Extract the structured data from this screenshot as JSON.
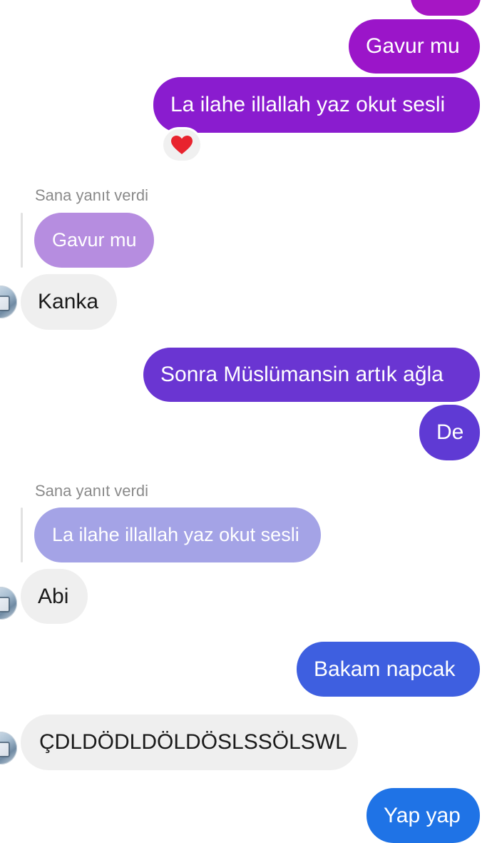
{
  "thread": {
    "reply_label": "Sana yanıt verdi",
    "messages": [
      {
        "id": "m1",
        "side": "out",
        "text": "Gavur mu",
        "color": "#9b15c9"
      },
      {
        "id": "m2",
        "side": "out",
        "text": "La ilahe illallah yaz okut sesli",
        "color": "#8a1ccf",
        "reaction": "heart-icon"
      },
      {
        "id": "m3",
        "side": "in",
        "reply_to": "Gavur mu",
        "reply_color": "#b68de0",
        "text": "Kanka"
      },
      {
        "id": "m4",
        "side": "out",
        "text": "Sonra Müslümansin artık ağla",
        "color": "#6a35d2"
      },
      {
        "id": "m5",
        "side": "out",
        "text": "De",
        "color": "#5f3ad4"
      },
      {
        "id": "m6",
        "side": "in",
        "reply_to": "La ilahe illallah yaz okut sesli",
        "reply_color": "#a4a3e6",
        "text": "Abi"
      },
      {
        "id": "m7",
        "side": "out",
        "text": "Bakam napcak",
        "color": "#3e5fe0"
      },
      {
        "id": "m8",
        "side": "in",
        "text": "ÇDLDÖDLDÖLDÖSLSSÖLSWL"
      },
      {
        "id": "m9",
        "side": "out",
        "text": "Yap yap",
        "color": "#1f73e6"
      }
    ]
  },
  "colors": {
    "incoming_bubble": "#efefef",
    "incoming_text": "#1a1a1a",
    "reply_label": "#8a8a8a",
    "heart": "#e8232e",
    "top_cutoff_bubble": "#a616c4"
  }
}
